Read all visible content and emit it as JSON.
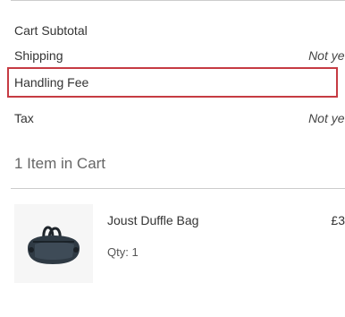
{
  "summary": {
    "rows": [
      {
        "label": "Cart Subtotal",
        "value": "£"
      },
      {
        "label": "Shipping",
        "value": "Not yet calcu"
      },
      {
        "label": "Handling Fee",
        "value": ""
      },
      {
        "label": "Tax",
        "value": "Not yet calcu"
      }
    ]
  },
  "cart": {
    "heading": "1 Item in Cart",
    "items": [
      {
        "name": "Joust Duffle Bag",
        "qty_label": "Qty: 1",
        "price": "£3",
        "thumbnail_icon": "duffle-bag-image"
      }
    ]
  },
  "colors": {
    "highlight_border": "#c63b43",
    "divider": "#cccccc"
  }
}
